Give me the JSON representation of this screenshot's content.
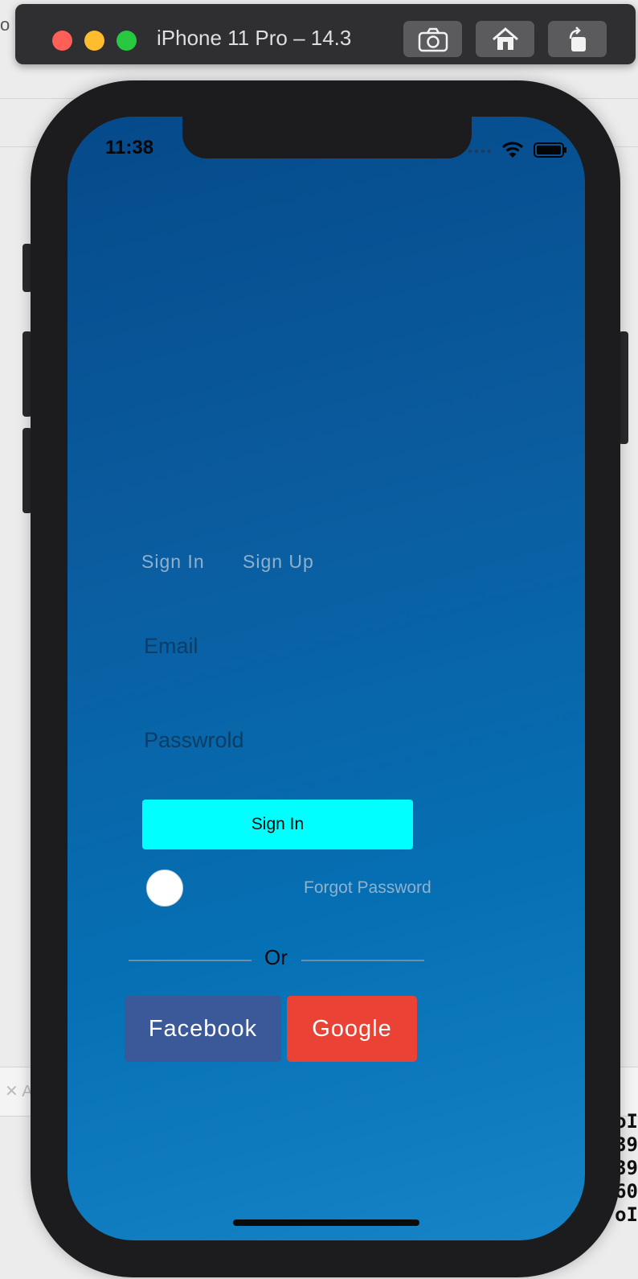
{
  "simulator": {
    "title": "iPhone 11 Pro – 14.3",
    "buttons": [
      "screenshot-icon",
      "home-icon",
      "rotate-icon"
    ]
  },
  "status_bar": {
    "time": "11:38"
  },
  "auth": {
    "tabs": [
      "Sign In",
      "Sign Up"
    ],
    "email_placeholder": "Email",
    "password_placeholder": "Passwrold",
    "signin_button": "Sign In",
    "forgot_password": "Forgot Password",
    "divider_text": "Or",
    "facebook_button": "Facebook",
    "google_button": "Google"
  },
  "colors": {
    "accent_button": "#00ffff",
    "facebook": "#3b5998",
    "google": "#ea4335",
    "screen_bg": "#0670b4"
  }
}
